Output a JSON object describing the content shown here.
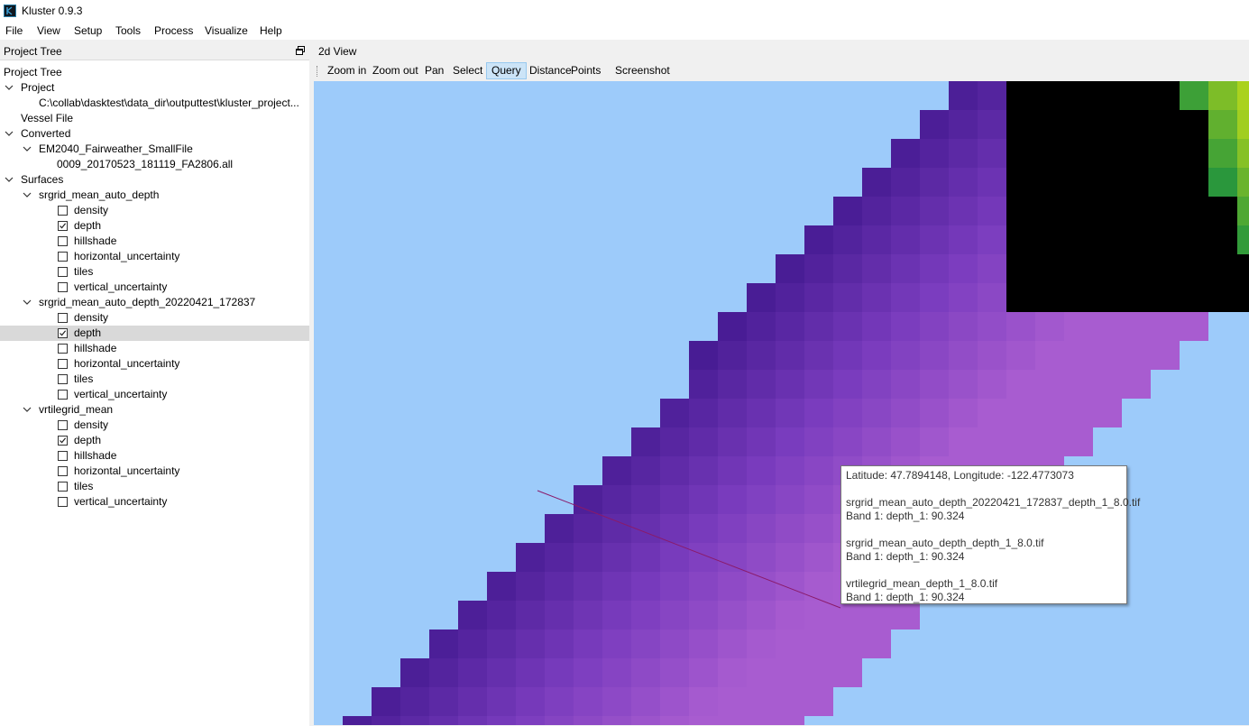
{
  "window": {
    "title": "Kluster 0.9.3"
  },
  "menu": [
    "File",
    "View",
    "Setup",
    "Tools",
    "Process",
    "Visualize",
    "Help"
  ],
  "project_tree": {
    "dock_title": "Project Tree",
    "root_label": "Project Tree",
    "project_label": "Project",
    "project_path": "C:\\collab\\dasktest\\data_dir\\outputtest\\kluster_project...",
    "vessel_label": "Vessel File",
    "converted_label": "Converted",
    "converted_item": "EM2040_Fairweather_SmallFile",
    "converted_file": "0009_20170523_181119_FA2806.all",
    "surfaces_label": "Surfaces",
    "surfaces": [
      {
        "name": "srgrid_mean_auto_depth",
        "layers": [
          {
            "label": "density",
            "checked": false
          },
          {
            "label": "depth",
            "checked": true
          },
          {
            "label": "hillshade",
            "checked": false
          },
          {
            "label": "horizontal_uncertainty",
            "checked": false
          },
          {
            "label": "tiles",
            "checked": false
          },
          {
            "label": "vertical_uncertainty",
            "checked": false
          }
        ]
      },
      {
        "name": "srgrid_mean_auto_depth_20220421_172837",
        "layers": [
          {
            "label": "density",
            "checked": false
          },
          {
            "label": "depth",
            "checked": true,
            "selected": true
          },
          {
            "label": "hillshade",
            "checked": false
          },
          {
            "label": "horizontal_uncertainty",
            "checked": false
          },
          {
            "label": "tiles",
            "checked": false
          },
          {
            "label": "vertical_uncertainty",
            "checked": false
          }
        ]
      },
      {
        "name": "vrtilegrid_mean",
        "layers": [
          {
            "label": "density",
            "checked": false
          },
          {
            "label": "depth",
            "checked": true
          },
          {
            "label": "hillshade",
            "checked": false
          },
          {
            "label": "horizontal_uncertainty",
            "checked": false
          },
          {
            "label": "tiles",
            "checked": false
          },
          {
            "label": "vertical_uncertainty",
            "checked": false
          }
        ]
      }
    ]
  },
  "view2d": {
    "dock_title": "2d View",
    "tools": [
      "Zoom in",
      "Zoom out",
      "Pan",
      "Select",
      "Query",
      "Distance",
      "Points",
      "Screenshot"
    ],
    "active_tool": "Query"
  },
  "query_popup": {
    "position": "Latitude: 47.7894148, Longitude: -122.4773073",
    "results": [
      {
        "file": "srgrid_mean_auto_depth_20220421_172837_depth_1_8.0.tif",
        "value": "Band 1: depth_1: 90.324"
      },
      {
        "file": "srgrid_mean_auto_depth_depth_1_8.0.tif",
        "value": "Band 1: depth_1: 90.324"
      },
      {
        "file": "vrtilegrid_mean_depth_1_8.0.tif",
        "value": "Band 1: depth_1: 90.324"
      }
    ]
  },
  "colors": {
    "water": "#9dcbfa",
    "surface_shallow": "#a055c8",
    "surface_deep": "#2a14e8",
    "selection": "#d9d9d9",
    "active_tool_bg": "#cce4f7"
  }
}
